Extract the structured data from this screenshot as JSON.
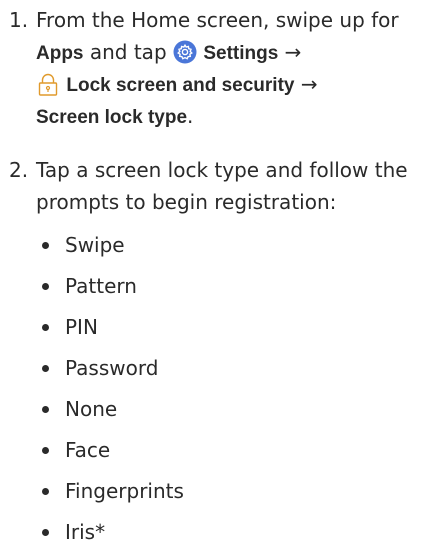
{
  "step1": {
    "number": "1.",
    "line1": "From the Home screen, swipe up for",
    "apps": "Apps",
    "and_tap": " and tap ",
    "settings": "Settings",
    "arrow": " →",
    "lock_screen": "Lock screen and security",
    "screen_lock_type": "Screen lock type",
    "period": ".",
    "settings_icon": "settings-gear-icon",
    "lock_icon": "padlock-icon",
    "accent_color": "#4a76d8"
  },
  "step2": {
    "number": "2.",
    "line1": "Tap a screen lock type and follow the",
    "line2": "prompts to begin registration:"
  },
  "lock_types": [
    "Swipe",
    "Pattern",
    "PIN",
    "Password",
    "None",
    "Face",
    "Fingerprints",
    "Iris*"
  ]
}
